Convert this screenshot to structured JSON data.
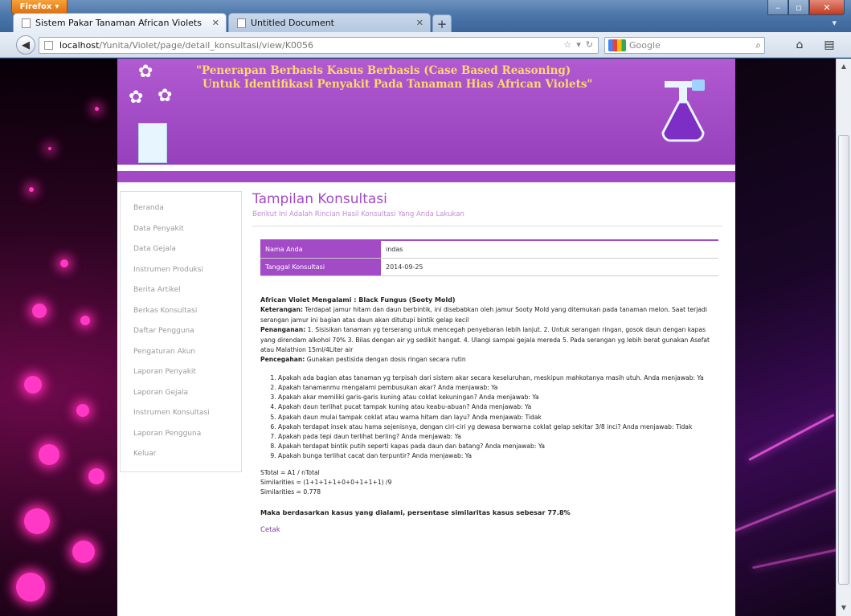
{
  "browser": {
    "app_button": "Firefox",
    "tabs": [
      {
        "title": "Sistem Pakar Tanaman African Violets",
        "active": true
      },
      {
        "title": "Untitled Document",
        "active": false
      }
    ],
    "url_host": "localhost",
    "url_path": "/Yunita/Violet/page/detail_konsultasi/view/K0056",
    "search_placeholder": "Google"
  },
  "banner": {
    "title_line1": "\"Penerapan Berbasis Kasus Berbasis (Case Based Reasoning)",
    "title_line2": "Untuk Identifikasi Penyakit Pada Tanaman Hias African Violets\""
  },
  "sidebar": {
    "items": [
      "Beranda",
      "Data Penyakit",
      "Data Gejala",
      "Instrumen Produksi",
      "Berita Artikel",
      "Berkas Konsultasi",
      "Daftar Pengguna",
      "Pengaturan Akun",
      "Laporan Penyakit",
      "Laporan Gejala",
      "Instrumen Konsultasi",
      "Laporan Pengguna",
      "Keluar"
    ]
  },
  "content": {
    "title": "Tampilan Konsultasi",
    "subtitle": "Berikut Ini Adalah Rincian Hasil Konsultasi Yang Anda Lakukan",
    "info": [
      {
        "label": "Nama Anda",
        "value": "indas"
      },
      {
        "label": "Tanggal Konsultasi",
        "value": "2014-09-25"
      }
    ],
    "diagnosis_line": "African Violet Mengalami : Black Fungus (Sooty Mold)",
    "keterangan_label": "Keterangan:",
    "keterangan_text": "Terdapat jamur hitam dan daun berbintik, ini disebabkan oleh jamur Sooty Mold yang ditemukan pada tanaman melon. Saat terjadi serangan jamur ini bagian atas daun akan ditutupi bintik gelap kecil",
    "penanganan_label": "Penanganan:",
    "penanganan_text": "1. Sisisikan tanaman yg terserang untuk mencegah penyebaran lebih lanjut. 2. Untuk serangan ringan, gosok daun dengan kapas yang direndam alkohol 70% 3. Bilas dengan air yg sedikit hangat. 4. Ulangi sampai gejala mereda 5. Pada serangan yg lebih berat gunakan Asefat atau Malathion 15ml/4Liter air",
    "pencegahan_label": "Pencegahan:",
    "pencegahan_text": "Gunakan pestisida dengan dosis ringan secara rutin",
    "questions": [
      "Apakah ada bagian atas tanaman yg terpisah dari sistem akar secara keseluruhan, meskipun mahkotanya masih utuh. Anda menjawab: Ya",
      "Apakah tanamanmu mengalami pembusukan akar? Anda menjawab: Ya",
      "Apakah akar memiliki garis-garis kuning atau coklat kekuningan? Anda menjawab: Ya",
      "Apakah daun terlihat pucat tampak kuning atau keabu-abuan? Anda menjawab: Ya",
      "Apakah daun mulai tampak coklat atau warna hitam dan layu? Anda menjawab: Tidak",
      "Apakah terdapat insek atau hama sejenisnya, dengan ciri-ciri yg dewasa berwarna coklat gelap sekitar 3/8 inci? Anda menjawab: Tidak",
      "Apakah pada tepi daun terlihat berling? Anda menjawab: Ya",
      "Apakah terdapat bintik putih seperti kapas pada daun dan batang? Anda menjawab: Ya",
      "Apakah bunga terlihat cacat dan terpuntir? Anda menjawab: Ya"
    ],
    "calc_line1": "STotal = A1 / nTotal",
    "calc_line2": "Similarities = (1+1+1+1+0+0+1+1+1) /9",
    "calc_line3": "Similarities = 0.778",
    "conclusion": "Maka berdasarkan kasus yang dialami, persentase similaritas kasus sebesar 77.8%",
    "print_link": "Cetak"
  },
  "colors": {
    "accent_purple": "#a34ac7",
    "title_yellow": "#ffd86b"
  }
}
